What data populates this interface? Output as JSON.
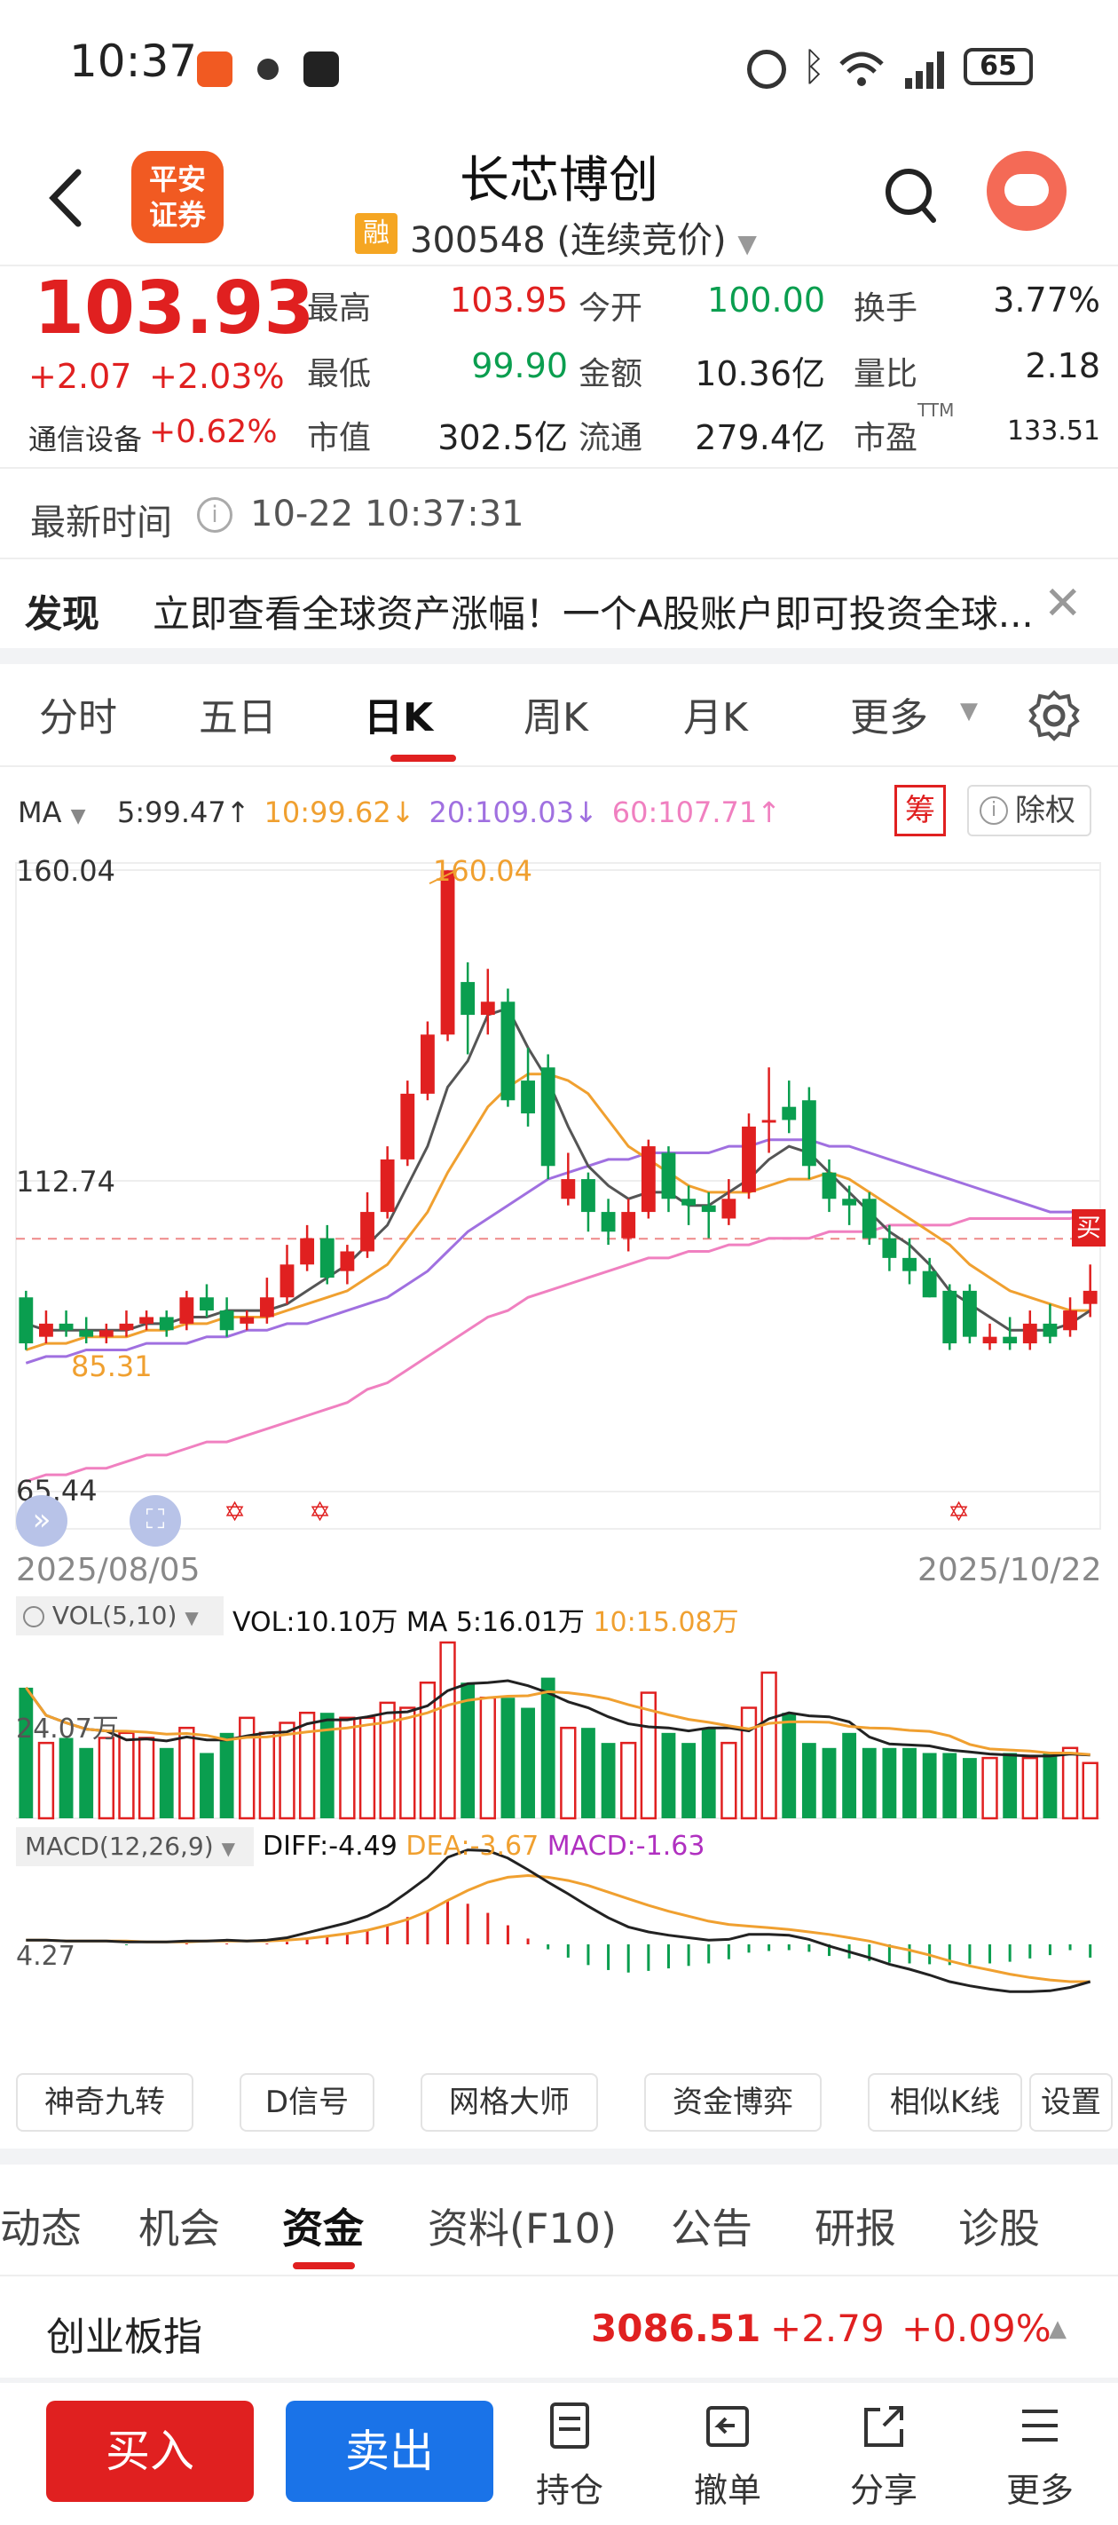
{
  "status_bar": {
    "time": "10:37",
    "battery": "65",
    "app_badge": "平安\n证券"
  },
  "header": {
    "app_logo": "平安\n证券",
    "stock_name": "长芯博创",
    "margin_tag": "融",
    "code_line": "300548 (连续竞价)"
  },
  "quote": {
    "price": "103.93",
    "change": "+2.07",
    "change_pct": "+2.03%",
    "sector": "通信设备",
    "sector_pct": "+0.62%",
    "rows": [
      [
        {
          "label": "最高",
          "value": "103.95",
          "color": "red"
        },
        {
          "label": "今开",
          "value": "100.00",
          "color": "green"
        },
        {
          "label": "换手",
          "value": "3.77%",
          "color": "dark"
        }
      ],
      [
        {
          "label": "最低",
          "value": "99.90",
          "color": "green"
        },
        {
          "label": "金额",
          "value": "10.36亿",
          "color": "dark"
        },
        {
          "label": "量比",
          "value": "2.18",
          "color": "dark"
        }
      ],
      [
        {
          "label": "市值",
          "value": "302.5亿",
          "color": "dark"
        },
        {
          "label": "流通",
          "value": "279.4亿",
          "color": "dark"
        },
        {
          "label": "市盈",
          "value": "133.51",
          "color": "dark"
        }
      ]
    ],
    "pe_sup": "TTM",
    "latest_time_label": "最新时间",
    "latest_time": "10-22 10:37:31"
  },
  "discover": {
    "label": "发现",
    "text": "立即查看全球资产涨幅！一个A股账户即可投资全球..."
  },
  "chart_tabs": [
    "分时",
    "五日",
    "日K",
    "周K",
    "月K",
    "更多"
  ],
  "active_chart_tab": 2,
  "ma_legend": {
    "label": "MA",
    "items": [
      {
        "text": "5:99.47↑",
        "color": "#333333"
      },
      {
        "text": "10:99.62↓",
        "color": "#f0a030"
      },
      {
        "text": "20:109.03↓",
        "color": "#a070e0"
      },
      {
        "text": "60:107.71↑",
        "color": "#f080c0"
      }
    ],
    "chip_btn": "筹",
    "adjust_btn": "除权"
  },
  "price_axis": {
    "top": "160.04",
    "mid": "112.74",
    "bottom": "65.44",
    "max_label": "160.04",
    "min_label": "85.31",
    "buy_tag": "买"
  },
  "date_axis": {
    "start": "2025/08/05",
    "end": "2025/10/22"
  },
  "vol_legend": {
    "label": "VOL(5,10)",
    "vol": "VOL:10.10万",
    "ma5": "MA 5:16.01万",
    "ma10": "10:15.08万",
    "axis_label": "24.07万"
  },
  "macd_legend": {
    "label": "MACD(12,26,9)",
    "diff": "DIFF:-4.49",
    "dea": "DEA:-3.67",
    "macd": "MACD:-1.63",
    "axis_label": "4.27"
  },
  "chart_tools": [
    "神奇九转",
    "D信号",
    "网格大师",
    "资金博弈",
    "相似K线",
    "设置"
  ],
  "info_tabs": [
    "动态",
    "机会",
    "资金",
    "资料(F10)",
    "公告",
    "研报",
    "诊股"
  ],
  "active_info_tab": 2,
  "index_bar": {
    "name": "创业板指",
    "value": "3086.51",
    "change": "+2.79",
    "pct": "+0.09%"
  },
  "bottom_bar": {
    "buy": "买入",
    "sell": "卖出",
    "items": [
      "持仓",
      "撤单",
      "分享",
      "更多"
    ]
  },
  "colors": {
    "up": "#e02020",
    "down": "#0a9e4f",
    "accent": "#f15a22",
    "sell": "#1a73e8"
  },
  "chart_data": {
    "type": "candlestick",
    "ylim": [
      65.44,
      160.04
    ],
    "candles": [
      [
        95,
        88,
        96,
        87
      ],
      [
        89,
        91,
        93,
        88
      ],
      [
        91,
        90,
        93,
        89
      ],
      [
        90,
        89,
        92,
        88
      ],
      [
        89,
        90,
        91,
        88
      ],
      [
        90,
        91,
        93,
        89
      ],
      [
        91,
        92,
        93,
        90
      ],
      [
        92,
        90,
        93,
        89
      ],
      [
        91,
        95,
        96,
        90
      ],
      [
        95,
        93,
        97,
        92
      ],
      [
        93,
        90,
        95,
        89
      ],
      [
        91,
        92,
        93,
        90
      ],
      [
        92,
        95,
        98,
        91
      ],
      [
        95,
        100,
        103,
        94
      ],
      [
        100,
        104,
        106,
        99
      ],
      [
        104,
        98,
        106,
        97
      ],
      [
        99,
        102,
        103,
        97
      ],
      [
        102,
        108,
        111,
        101
      ],
      [
        108,
        116,
        118,
        107
      ],
      [
        116,
        126,
        128,
        115
      ],
      [
        126,
        135,
        137,
        125
      ],
      [
        135,
        160,
        160,
        134
      ],
      [
        143,
        138,
        146,
        132
      ],
      [
        138,
        140,
        145,
        135
      ],
      [
        140,
        125,
        142,
        124
      ],
      [
        128,
        123,
        133,
        121
      ],
      [
        130,
        115,
        132,
        113
      ],
      [
        110,
        113,
        117,
        109
      ],
      [
        113,
        108,
        114,
        105
      ],
      [
        108,
        105,
        110,
        103
      ],
      [
        104,
        108,
        110,
        102
      ],
      [
        108,
        118,
        119,
        107
      ],
      [
        117,
        110,
        118,
        108
      ],
      [
        110,
        109,
        112,
        106
      ],
      [
        109,
        108,
        111,
        104
      ],
      [
        107,
        110,
        113,
        106
      ],
      [
        111,
        121,
        123,
        110
      ],
      [
        122,
        122,
        130,
        117
      ],
      [
        124,
        122,
        128,
        120
      ],
      [
        125,
        115,
        127,
        113
      ],
      [
        114,
        110,
        116,
        108
      ],
      [
        110,
        109,
        112,
        106
      ],
      [
        110,
        104,
        111,
        103
      ],
      [
        104,
        101,
        106,
        99
      ],
      [
        101,
        99,
        104,
        97
      ],
      [
        99,
        95,
        101,
        95
      ],
      [
        96,
        88,
        97,
        87
      ],
      [
        96,
        89,
        97,
        88
      ],
      [
        88,
        89,
        91,
        87
      ],
      [
        89,
        88,
        92,
        87
      ],
      [
        88,
        91,
        93,
        87
      ],
      [
        91,
        89,
        94,
        88
      ],
      [
        90,
        93,
        95,
        89
      ],
      [
        94,
        96,
        100,
        92
      ]
    ],
    "ma5": [
      91,
      90,
      90,
      90,
      90,
      90,
      91,
      91,
      92,
      92,
      93,
      93,
      93,
      94,
      96,
      98,
      100,
      103,
      106,
      112,
      118,
      127,
      131,
      138,
      139,
      133,
      128,
      121,
      115,
      112,
      110,
      111,
      111,
      109,
      109,
      111,
      113,
      116,
      118,
      117,
      114,
      111,
      108,
      105,
      103,
      100,
      96,
      94,
      92,
      90,
      90,
      90,
      91,
      93
    ],
    "ma10": [
      87,
      88,
      88,
      89,
      89,
      89,
      90,
      90,
      91,
      91,
      92,
      92,
      92,
      93,
      94,
      95,
      96,
      98,
      100,
      104,
      108,
      114,
      119,
      124,
      127,
      129,
      129,
      128,
      126,
      122,
      118,
      116,
      114,
      112,
      111,
      111,
      111,
      112,
      113,
      113,
      114,
      113,
      111,
      109,
      107,
      105,
      103,
      100,
      98,
      96,
      95,
      94,
      93,
      93
    ],
    "ma20": [
      85,
      86,
      86,
      87,
      87,
      87,
      88,
      88,
      88,
      89,
      89,
      90,
      90,
      91,
      91,
      92,
      93,
      94,
      95,
      97,
      99,
      102,
      105,
      107,
      109,
      111,
      113,
      114,
      115,
      116,
      116,
      117,
      117,
      117,
      117,
      118,
      118,
      119,
      119,
      119,
      118,
      118,
      117,
      116,
      115,
      114,
      113,
      112,
      111,
      110,
      109,
      108,
      108,
      108
    ],
    "ma60": [
      67,
      68,
      68,
      69,
      69,
      70,
      71,
      71,
      72,
      73,
      73,
      74,
      75,
      76,
      77,
      78,
      79,
      81,
      82,
      84,
      86,
      88,
      90,
      92,
      93,
      95,
      96,
      97,
      98,
      99,
      100,
      101,
      101,
      102,
      102,
      103,
      103,
      104,
      104,
      104,
      105,
      105,
      105,
      106,
      106,
      106,
      106,
      107,
      107,
      107,
      107,
      107,
      107,
      108
    ],
    "volume": [
      26,
      15,
      16,
      14,
      16,
      17,
      16,
      14,
      18,
      13,
      17,
      20,
      17,
      19,
      21,
      21,
      20,
      20,
      23,
      22,
      27,
      35,
      27,
      24,
      24,
      22,
      28,
      18,
      18,
      15,
      15,
      25,
      17,
      15,
      18,
      15,
      22,
      29,
      21,
      15,
      14,
      17,
      14,
      14,
      14,
      13,
      13,
      12,
      12,
      13,
      12,
      13,
      14,
      11
    ],
    "macd_diff": [
      0.5,
      0.5,
      0.4,
      0.4,
      0.4,
      0.3,
      0.3,
      0.3,
      0.4,
      0.4,
      0.5,
      0.4,
      0.5,
      0.8,
      1.4,
      2.0,
      2.6,
      3.4,
      4.6,
      6.3,
      8.1,
      10.5,
      11.4,
      11.3,
      10.4,
      9.0,
      7.5,
      6.1,
      4.6,
      3.2,
      2.1,
      1.5,
      1.1,
      0.8,
      0.5,
      0.6,
      1.2,
      1.2,
      1.1,
      0.6,
      -0.2,
      -0.9,
      -1.6,
      -2.4,
      -3.0,
      -3.7,
      -4.5,
      -5.0,
      -5.4,
      -5.7,
      -5.7,
      -5.6,
      -5.2,
      -4.5
    ],
    "macd_dea": [
      0.5,
      0.5,
      0.4,
      0.4,
      0.4,
      0.4,
      0.3,
      0.3,
      0.3,
      0.4,
      0.4,
      0.4,
      0.4,
      0.5,
      0.7,
      1.0,
      1.3,
      1.7,
      2.3,
      3.0,
      4.0,
      5.3,
      6.5,
      7.5,
      8.1,
      8.3,
      8.1,
      7.7,
      7.1,
      6.3,
      5.5,
      4.7,
      4.0,
      3.4,
      2.8,
      2.4,
      2.2,
      2.0,
      1.8,
      1.5,
      1.2,
      0.8,
      0.4,
      -0.2,
      -0.7,
      -1.3,
      -2.0,
      -2.6,
      -3.1,
      -3.6,
      -4.0,
      -4.3,
      -4.5,
      -4.5
    ],
    "macd_hist": [
      0,
      0,
      0,
      0,
      0,
      -0.1,
      0,
      0,
      0.1,
      0,
      0.1,
      0,
      0.1,
      0.3,
      0.7,
      1.0,
      1.3,
      1.7,
      2.3,
      3.3,
      4.1,
      5.2,
      4.9,
      3.8,
      2.3,
      0.7,
      -0.6,
      -1.6,
      -2.5,
      -3.1,
      -3.4,
      -3.2,
      -2.9,
      -2.6,
      -2.3,
      -1.8,
      -1.0,
      -0.8,
      -0.7,
      -0.9,
      -1.4,
      -1.7,
      -2.0,
      -2.2,
      -2.3,
      -2.4,
      -2.5,
      -2.4,
      -2.3,
      -2.1,
      -1.7,
      -1.3,
      -0.7,
      -1.6
    ]
  }
}
